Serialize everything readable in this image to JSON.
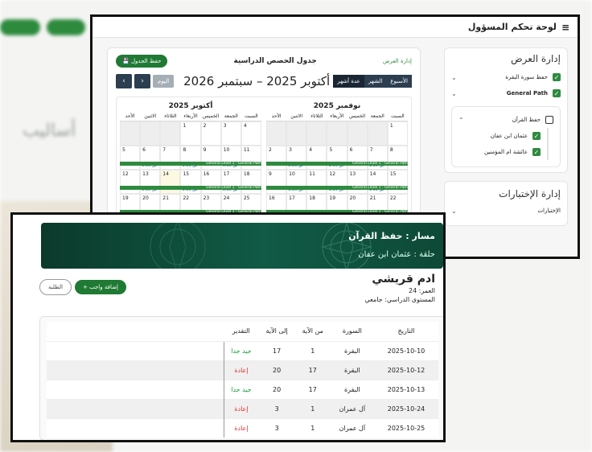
{
  "background": {
    "text_fragment": "أساليب"
  },
  "admin": {
    "header_title": "لوحة تحكم المسؤول",
    "sidebar": {
      "section_title": "إدارة العرض",
      "items": [
        {
          "label": "حفظ سورة البقرة",
          "checked": true
        },
        {
          "label": "General Path",
          "checked": true
        }
      ],
      "group": {
        "label": "حفظ القرآن",
        "checked": false,
        "children": [
          {
            "label": "عثمان ابن عفان",
            "checked": true
          },
          {
            "label": "عائشة ام المؤمنين",
            "checked": true
          }
        ]
      },
      "exams_title": "إدارة الإختبارات",
      "exams_item": "الإختبارات"
    },
    "calendar": {
      "admin_link": "إدارة العرض",
      "title": "جدول الحصص الدراسية",
      "save_button": "حفظ الجدول",
      "views": [
        "الأسبوع",
        "الشهر",
        "عدة أشهر"
      ],
      "active_view": "عدة أشهر",
      "range": "أكتوبر 2025 – سبتمبر 2026",
      "today": "اليوم",
      "weekdays": [
        "السبت",
        "الجمعة",
        "الخميس",
        "الأربعاء",
        "الثلاثاء",
        "الاثنين",
        "الأحد"
      ],
      "event_time": "1:35 ص",
      "event_name": "General Level 1 - General Path",
      "months": [
        {
          "name": "أكتوبر 2025",
          "rows": [
            [
              "4",
              "3",
              "2",
              "1",
              "",
              "",
              ""
            ],
            [
              "11",
              "10",
              "9",
              "8",
              "7",
              "6",
              "5"
            ],
            [
              "18",
              "17",
              "16",
              "15",
              "14",
              "13",
              "12"
            ],
            [
              "25",
              "24",
              "23",
              "22",
              "21",
              "20",
              "19"
            ]
          ]
        },
        {
          "name": "نوفمبر 2025",
          "rows": [
            [
              "1",
              "",
              "",
              "",
              "",
              "",
              ""
            ],
            [
              "8",
              "7",
              "6",
              "5",
              "4",
              "3",
              "2"
            ],
            [
              "15",
              "14",
              "13",
              "12",
              "11",
              "10",
              "9"
            ],
            [
              "22",
              "21",
              "20",
              "19",
              "18",
              "17",
              "16"
            ]
          ]
        }
      ]
    }
  },
  "student": {
    "track": "مسار : حفظ القرآن",
    "circle": "حلقة : عثمان ابن عفان",
    "name": "ادم قريشي",
    "age": "العمر: 24",
    "level": "المستوى الدراسي: جامعي",
    "add_button": "+ إضافة واجب",
    "back_button": "الطلبة",
    "columns": [
      "التاريخ",
      "السورة",
      "من الآية",
      "إلى الآية",
      "التقدير"
    ],
    "rows": [
      {
        "date": "2025-10-10",
        "surah": "البقرة",
        "from": "1",
        "to": "17",
        "grade": "جيد جدا",
        "status": "good"
      },
      {
        "date": "2025-10-12",
        "surah": "البقرة",
        "from": "17",
        "to": "20",
        "grade": "إعادة",
        "status": "redo"
      },
      {
        "date": "2025-10-13",
        "surah": "البقرة",
        "from": "17",
        "to": "20",
        "grade": "جيد جدا",
        "status": "good"
      },
      {
        "date": "2025-10-24",
        "surah": "آل عمران",
        "from": "1",
        "to": "3",
        "grade": "إعادة",
        "status": "redo"
      },
      {
        "date": "2025-10-25",
        "surah": "آل عمران",
        "from": "1",
        "to": "3",
        "grade": "إعادة",
        "status": "redo"
      }
    ]
  }
}
